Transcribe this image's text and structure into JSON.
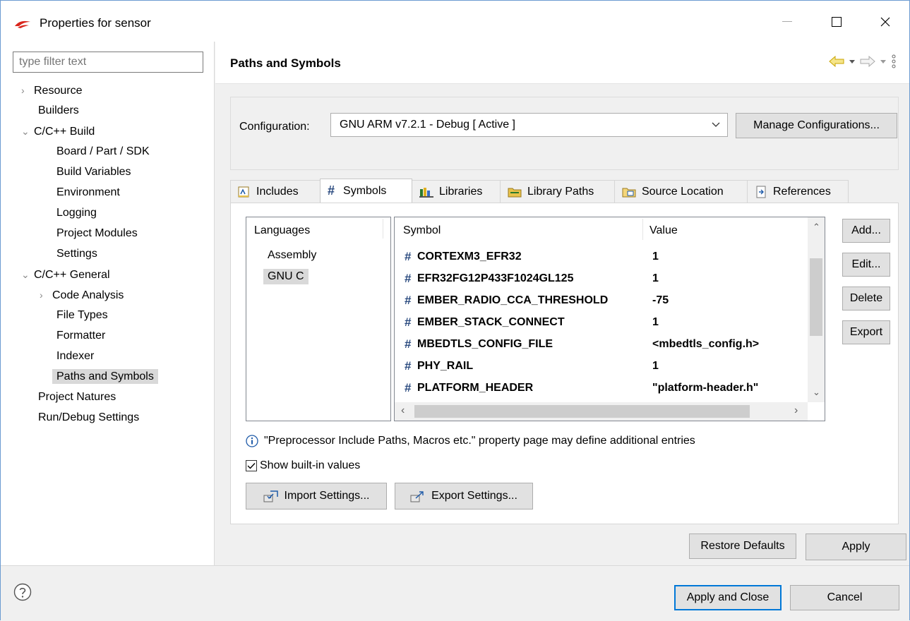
{
  "window": {
    "title": "Properties for sensor"
  },
  "left": {
    "filter_placeholder": "type filter text",
    "tree": [
      {
        "label": "Resource",
        "twisty": "›"
      },
      {
        "label": "Builders",
        "twisty": ""
      },
      {
        "label": "C/C++ Build",
        "twisty": "⌄"
      },
      {
        "label": "Board / Part / SDK",
        "twisty": ""
      },
      {
        "label": "Build Variables",
        "twisty": ""
      },
      {
        "label": "Environment",
        "twisty": ""
      },
      {
        "label": "Logging",
        "twisty": ""
      },
      {
        "label": "Project Modules",
        "twisty": ""
      },
      {
        "label": "Settings",
        "twisty": ""
      },
      {
        "label": "C/C++ General",
        "twisty": "⌄"
      },
      {
        "label": "Code Analysis",
        "twisty": "›"
      },
      {
        "label": "File Types",
        "twisty": ""
      },
      {
        "label": "Formatter",
        "twisty": ""
      },
      {
        "label": "Indexer",
        "twisty": ""
      },
      {
        "label": "Paths and Symbols",
        "twisty": ""
      },
      {
        "label": "Project Natures",
        "twisty": ""
      },
      {
        "label": "Run/Debug Settings",
        "twisty": ""
      }
    ]
  },
  "page": {
    "title": "Paths and Symbols",
    "configuration_label": "Configuration:",
    "configuration_value": "GNU ARM v7.2.1 - Debug  [ Active ]",
    "manage_label": "Manage Configurations...",
    "tabs": [
      {
        "label": "Includes"
      },
      {
        "label": "Symbols"
      },
      {
        "label": "Libraries"
      },
      {
        "label": "Library Paths"
      },
      {
        "label": "Source Location"
      },
      {
        "label": "References"
      }
    ],
    "languages_header": "Languages",
    "languages": [
      "Assembly",
      "GNU C"
    ],
    "table": {
      "col_symbol": "Symbol",
      "col_value": "Value",
      "rows": [
        {
          "symbol": "CORTEXM3_EFR32",
          "value": "1"
        },
        {
          "symbol": "EFR32FG12P433F1024GL125",
          "value": "1"
        },
        {
          "symbol": "EMBER_RADIO_CCA_THRESHOLD",
          "value": "-75"
        },
        {
          "symbol": "EMBER_STACK_CONNECT",
          "value": "1"
        },
        {
          "symbol": "MBEDTLS_CONFIG_FILE",
          "value": "<mbedtls_config.h>"
        },
        {
          "symbol": "PHY_RAIL",
          "value": "1"
        },
        {
          "symbol": "PLATFORM_HEADER",
          "value": "\"platform-header.h\""
        }
      ]
    },
    "side_buttons": {
      "add": "Add...",
      "edit": "Edit...",
      "delete": "Delete",
      "export": "Export"
    },
    "info_text": "\"Preprocessor Include Paths, Macros etc.\" property page may define additional entries",
    "show_builtin_label": "Show built-in values",
    "import_label": "Import Settings...",
    "export_label": "Export Settings...",
    "restore_label": "Restore Defaults",
    "apply_label": "Apply"
  },
  "footer": {
    "apply_close_label": "Apply and Close",
    "cancel_label": "Cancel"
  },
  "colors": {
    "accent": "#0078d7",
    "logo": "#d9261c"
  }
}
